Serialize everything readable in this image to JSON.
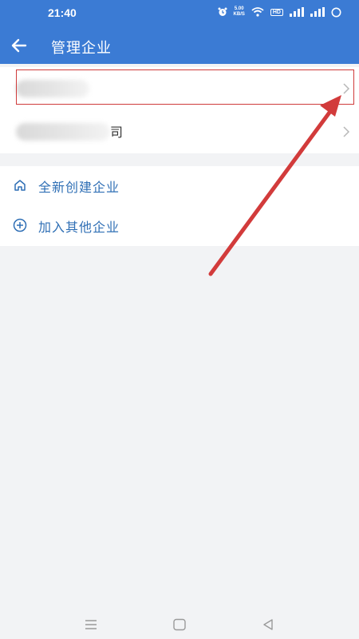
{
  "status_bar": {
    "time": "21:40",
    "network_speed_value": "5.00",
    "network_speed_unit": "KB/S",
    "hd_label": "HD"
  },
  "app_bar": {
    "title": "管理企业"
  },
  "companies": [
    {
      "name_visible_tail": ""
    },
    {
      "name_visible_tail": "司"
    }
  ],
  "actions": [
    {
      "label": "全新创建企业",
      "icon": "home-icon"
    },
    {
      "label": "加入其他企业",
      "icon": "plus-circle-icon"
    }
  ],
  "colors": {
    "primary": "#3b7bd4",
    "action_text": "#2f6fb5",
    "annotation_red": "#d23b3b",
    "background": "#f2f3f5"
  }
}
